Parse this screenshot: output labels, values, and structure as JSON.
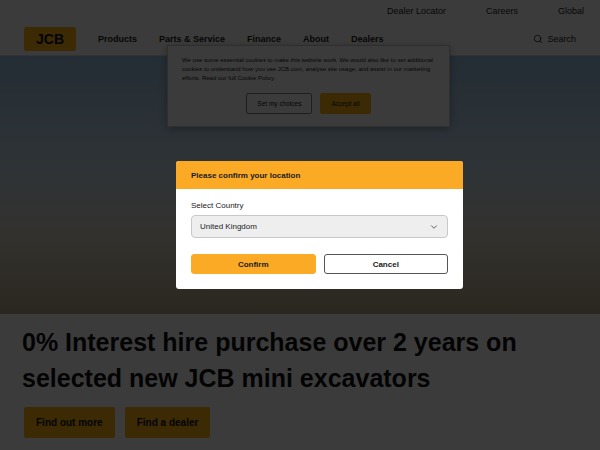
{
  "top_links": [
    "Dealer Locator",
    "Careers",
    "Global"
  ],
  "nav": {
    "logo": "JCB",
    "items": [
      "Products",
      "Parts & Service",
      "Finance",
      "About",
      "Dealers"
    ],
    "search": "Search"
  },
  "hero": {
    "headline": "0% Interest hire purchase over 2 years on selected new JCB mini excavators",
    "buttons": [
      "Find out more",
      "Find a dealer"
    ]
  },
  "cookie_banner": {
    "text": "We use some essential cookies to make this website work. We would also like to set additional cookies to understand how you use JCB.com, analyse site usage, and assist in our marketing efforts. Read our full Cookie Policy.",
    "buttons": [
      {
        "label": "Set my choices",
        "kind": "outline"
      },
      {
        "label": "Accept all",
        "kind": "filled"
      }
    ]
  },
  "dialog": {
    "title": "Please confirm your location",
    "field_label": "Select Country",
    "value": "United Kingdom",
    "buttons": [
      {
        "label": "Confirm",
        "kind": "primary"
      },
      {
        "label": "Cancel",
        "kind": "secondary"
      }
    ]
  }
}
